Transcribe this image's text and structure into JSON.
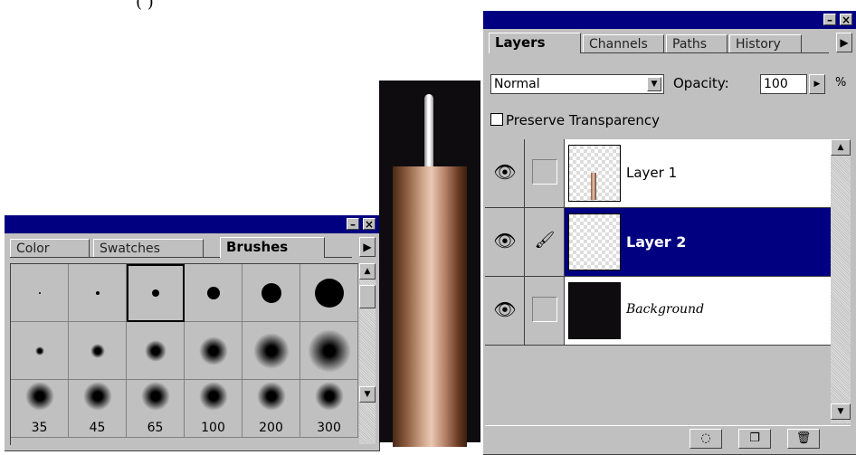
{
  "header": {
    "fragment": "(                                                   )"
  },
  "brushes_palette": {
    "tabs": [
      "Color",
      "Swatches",
      "Brushes"
    ],
    "active_tab": "Brushes",
    "minimize_label": "–",
    "close_label": "×",
    "menu_arrow": "▶",
    "brush_sizes": [
      "35",
      "45",
      "65",
      "100",
      "200",
      "300"
    ],
    "scroll_up": "▲",
    "scroll_down": "▼"
  },
  "layers_palette": {
    "tabs": [
      "Layers",
      "Channels",
      "Paths",
      "History"
    ],
    "active_tab": "Layers",
    "minimize_label": "–",
    "close_label": "×",
    "menu_arrow": "▶",
    "blend_mode": "Normal",
    "opacity_label": "Opacity:",
    "opacity_value": "100",
    "percent": "%",
    "preserve_transparency_label": "Preserve Transparency",
    "layers": [
      {
        "name": "Layer 1",
        "visible": true,
        "selected": false
      },
      {
        "name": "Layer 2",
        "visible": true,
        "selected": true
      },
      {
        "name": "Background",
        "visible": true,
        "selected": false
      }
    ],
    "eye_glyph": "👁",
    "brush_glyph": "🖌"
  },
  "colors": {
    "titlebar": "#000080",
    "selection": "#000080",
    "panel": "#c0c0c0",
    "image_bg": "#0f0c10"
  }
}
